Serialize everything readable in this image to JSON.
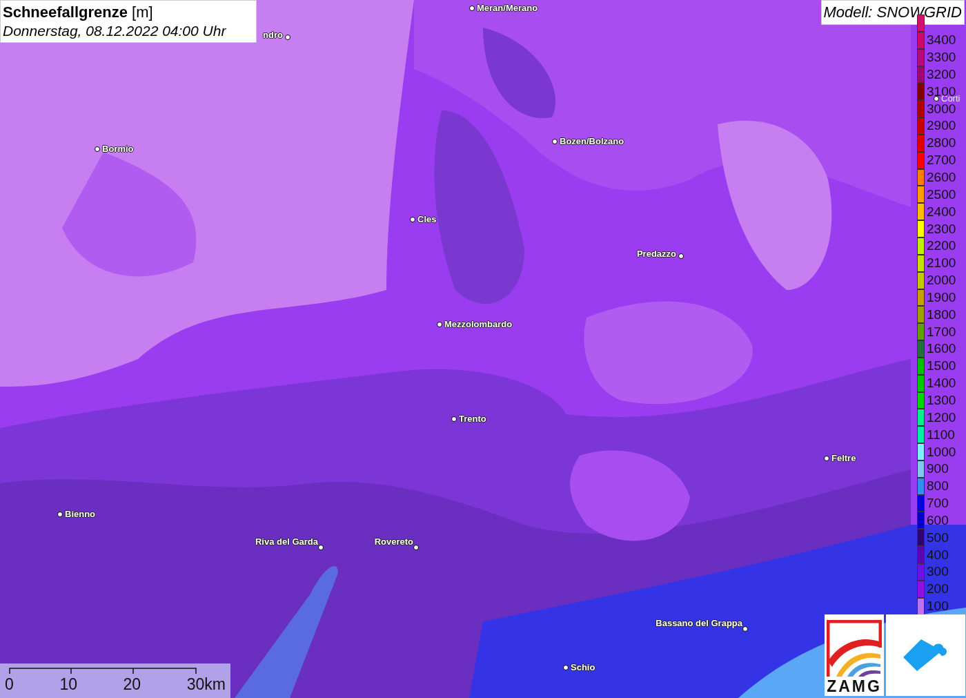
{
  "title": {
    "name": "Schneefallgrenze",
    "unit": "[m]",
    "datetime": "Donnerstag, 08.12.2022 04:00 Uhr"
  },
  "model": "Modell: SNOWGRID",
  "places": [
    {
      "name": "Meran/Merano"
    },
    {
      "name": "ndro"
    },
    {
      "name": "Bormio"
    },
    {
      "name": "Bozen/Bolzano"
    },
    {
      "name": "Cles"
    },
    {
      "name": "Predazzo"
    },
    {
      "name": "Mezzolombardo"
    },
    {
      "name": "Trento"
    },
    {
      "name": "Feltre"
    },
    {
      "name": "Bienno"
    },
    {
      "name": "Riva del Garda"
    },
    {
      "name": "Rovereto"
    },
    {
      "name": "Bassano del Grappa"
    },
    {
      "name": "Schio"
    },
    {
      "name": "Corti"
    }
  ],
  "legend": [
    {
      "color": "#d4106e"
    },
    {
      "label": "3400",
      "color": "#cc0a66"
    },
    {
      "label": "3300",
      "color": "#b8087a"
    },
    {
      "label": "3200",
      "color": "#a0066e"
    },
    {
      "label": "3100",
      "color": "#800000"
    },
    {
      "label": "3000",
      "color": "#b00000"
    },
    {
      "label": "2900",
      "color": "#c80000"
    },
    {
      "label": "2800",
      "color": "#e00000"
    },
    {
      "label": "2700",
      "color": "#ff0000"
    },
    {
      "label": "2600",
      "color": "#ff8000"
    },
    {
      "label": "2500",
      "color": "#ffa000"
    },
    {
      "label": "2400",
      "color": "#ffc000"
    },
    {
      "label": "2300",
      "color": "#ffff00"
    },
    {
      "label": "2200",
      "color": "#c0f000"
    },
    {
      "label": "2100",
      "color": "#c8e000"
    },
    {
      "label": "2000",
      "color": "#c8c800"
    },
    {
      "label": "1900",
      "color": "#c8a000"
    },
    {
      "label": "1800",
      "color": "#a0a000"
    },
    {
      "label": "1700",
      "color": "#60a000"
    },
    {
      "label": "1600",
      "color": "#207040"
    },
    {
      "label": "1500",
      "color": "#00c000"
    },
    {
      "label": "1400",
      "color": "#00c800"
    },
    {
      "label": "1300",
      "color": "#00d800"
    },
    {
      "label": "1200",
      "color": "#00f090"
    },
    {
      "label": "1100",
      "color": "#00f0a0"
    },
    {
      "label": "1000",
      "color": "#80f0ff"
    },
    {
      "label": "900",
      "color": "#80c8f0"
    },
    {
      "label": "800",
      "color": "#3090f0"
    },
    {
      "label": "700",
      "color": "#0000e0"
    },
    {
      "label": "600",
      "color": "#0000c8"
    },
    {
      "label": "500",
      "color": "#300070"
    },
    {
      "label": "400",
      "color": "#6000b0"
    },
    {
      "label": "300",
      "color": "#7010e0"
    },
    {
      "label": "200",
      "color": "#9010e0"
    },
    {
      "label": "100",
      "color": "#c070f0"
    }
  ],
  "scale": {
    "labels": [
      "0",
      "10",
      "20",
      "30km"
    ]
  },
  "logos": {
    "zamg": "ZAMG"
  }
}
